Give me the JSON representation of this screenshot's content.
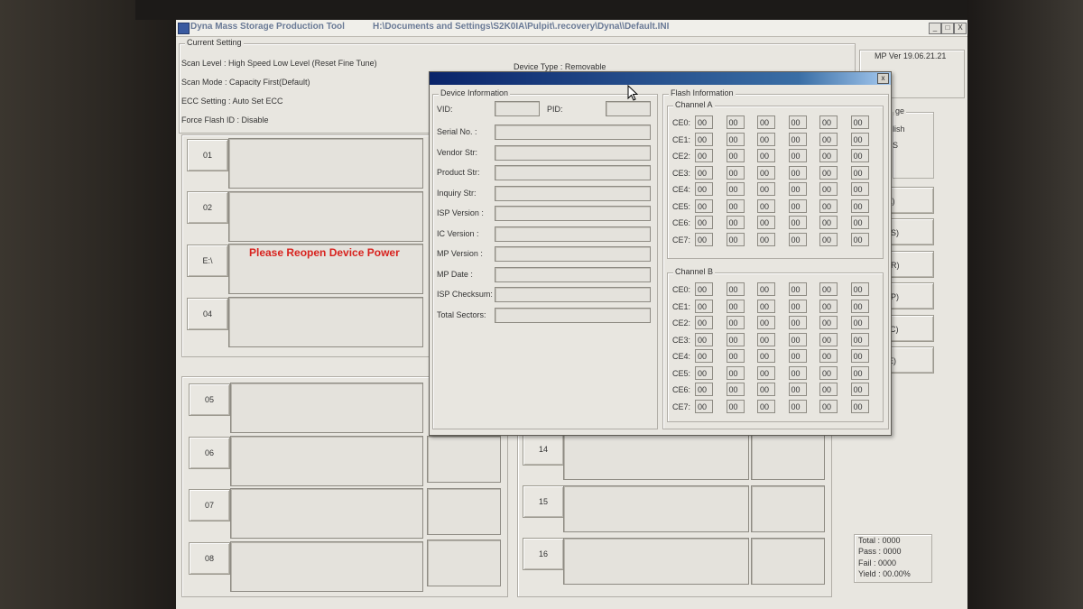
{
  "window": {
    "app_title": "Dyna Mass Storage Production Tool",
    "path": "H:\\Documents and Settings\\S2K0IA\\Pulpit\\.recovery\\Dyna\\\\Default.INI",
    "minimize": "_",
    "maximize": "□",
    "close": "X"
  },
  "current_setting": {
    "label": "Current Setting",
    "scan_level": "Scan Level : High Speed Low Level (Reset Fine Tune)",
    "scan_mode": "Scan Mode : Capacity First(Default)",
    "ecc_setting": "ECC Setting : Auto Set ECC",
    "force_flash_id": "Force Flash ID : Disable",
    "device_type": "Device Type : Removable"
  },
  "version": "MP Ver 19.06.21.21",
  "storage_group": {
    "label_fragment": "ge",
    "text_fragment_1": "lish",
    "text_fragment_2": "S"
  },
  "side_buttons": [
    "rt(A)",
    "ng(S)",
    "an(R)",
    "op(P)",
    "ck(C)",
    "ct(E)"
  ],
  "ports": {
    "p01": "01",
    "p02": "02",
    "p03": "E:\\",
    "p04": "04",
    "p05": "05",
    "p06": "06",
    "p07": "07",
    "p08": "08",
    "p14": "14",
    "p15": "15",
    "p16": "16"
  },
  "warning": "Please Reopen Device Power",
  "stats": {
    "total": "Total : 0000",
    "pass": "Pass : 0000",
    "fail": "Fail   : 0000",
    "yield": "Yield : 00.00%"
  },
  "dialog": {
    "close": "x",
    "device_info_label": "Device Information",
    "vid": "VID:",
    "pid": "PID:",
    "fields": [
      "Serial No. :",
      "Vendor Str:",
      "Product Str:",
      "Inquiry Str:",
      "ISP Version :",
      "IC Version :",
      "MP Version :",
      "MP Date :",
      "ISP Checksum:",
      "Total Sectors:"
    ],
    "flash_info_label": "Flash Information",
    "channel_a": "Channel A",
    "channel_b": "Channel B",
    "ce_rows": [
      "CE0:",
      "CE1:",
      "CE2:",
      "CE3:",
      "CE4:",
      "CE5:",
      "CE6:",
      "CE7:"
    ],
    "cell_value": "00"
  }
}
